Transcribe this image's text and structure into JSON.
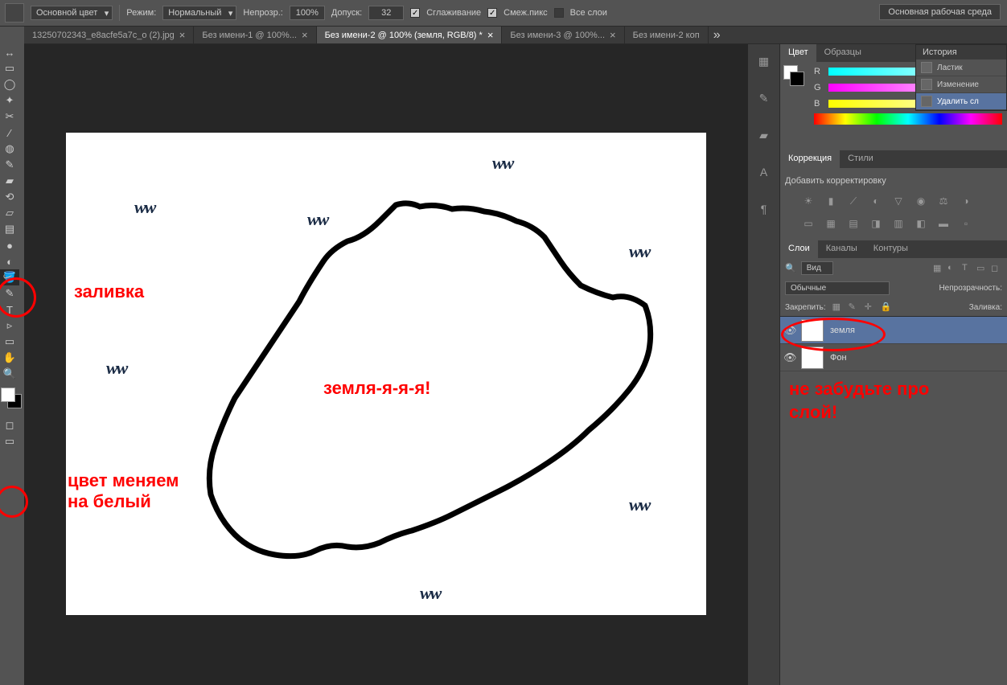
{
  "options": {
    "fill_mode": "Основной цвет",
    "mode_label": "Режим:",
    "mode_value": "Нормальный",
    "opacity_label": "Непрозр.:",
    "opacity_value": "100%",
    "tolerance_label": "Допуск:",
    "tolerance_value": "32",
    "antialias": "Сглаживание",
    "contiguous": "Смеж.пикс",
    "all_layers": "Все слои",
    "workspace": "Основная рабочая среда"
  },
  "tabs": [
    {
      "label": "13250702343_e8acfe5a7c_o (2).jpg",
      "close": "×"
    },
    {
      "label": "Без имени-1 @ 100%...",
      "close": "×"
    },
    {
      "label": "Без имени-2 @ 100% (земля, RGB/8) *",
      "close": "×",
      "active": true
    },
    {
      "label": "Без имени-3 @ 100%...",
      "close": "×"
    },
    {
      "label": "Без имени-2 коп"
    }
  ],
  "tabs_overflow": "»",
  "panels": {
    "color_tab": "Цвет",
    "swatches_tab": "Образцы",
    "r": "R",
    "g": "G",
    "b": "B",
    "history_tab": "История",
    "history_items": [
      {
        "label": "Ластик"
      },
      {
        "label": "Изменение"
      },
      {
        "label": "Удалить сл",
        "active": true
      }
    ],
    "adjust_tab": "Коррекция",
    "styles_tab": "Стили",
    "add_adjust": "Добавить корректировку",
    "layers_tab": "Слои",
    "channels_tab": "Каналы",
    "paths_tab": "Контуры",
    "kind_label": "Вид",
    "blend_mode": "Обычные",
    "opacity_label2": "Непрозрачность:",
    "lock_label": "Закрепить:",
    "fill_label": "Заливка:",
    "layers": [
      {
        "name": "земля",
        "selected": true
      },
      {
        "name": "Фон"
      }
    ]
  },
  "annotations": {
    "fill_tool": "заливка",
    "color_change": "цвет меняем\nна белый",
    "earth_text": "земля-я-я-я!",
    "layer_reminder": "не забудьте про слой!"
  },
  "tool_glyphs": [
    "↔",
    "▭",
    "◯",
    "⊹",
    "✦",
    "✂",
    "⌕",
    "✎",
    "▰",
    "⟋",
    "⬚",
    "◉",
    "⟲",
    "▤",
    "✋",
    "🔍",
    "✎",
    "T",
    "▹",
    "⬡",
    "✋",
    "🔍"
  ]
}
